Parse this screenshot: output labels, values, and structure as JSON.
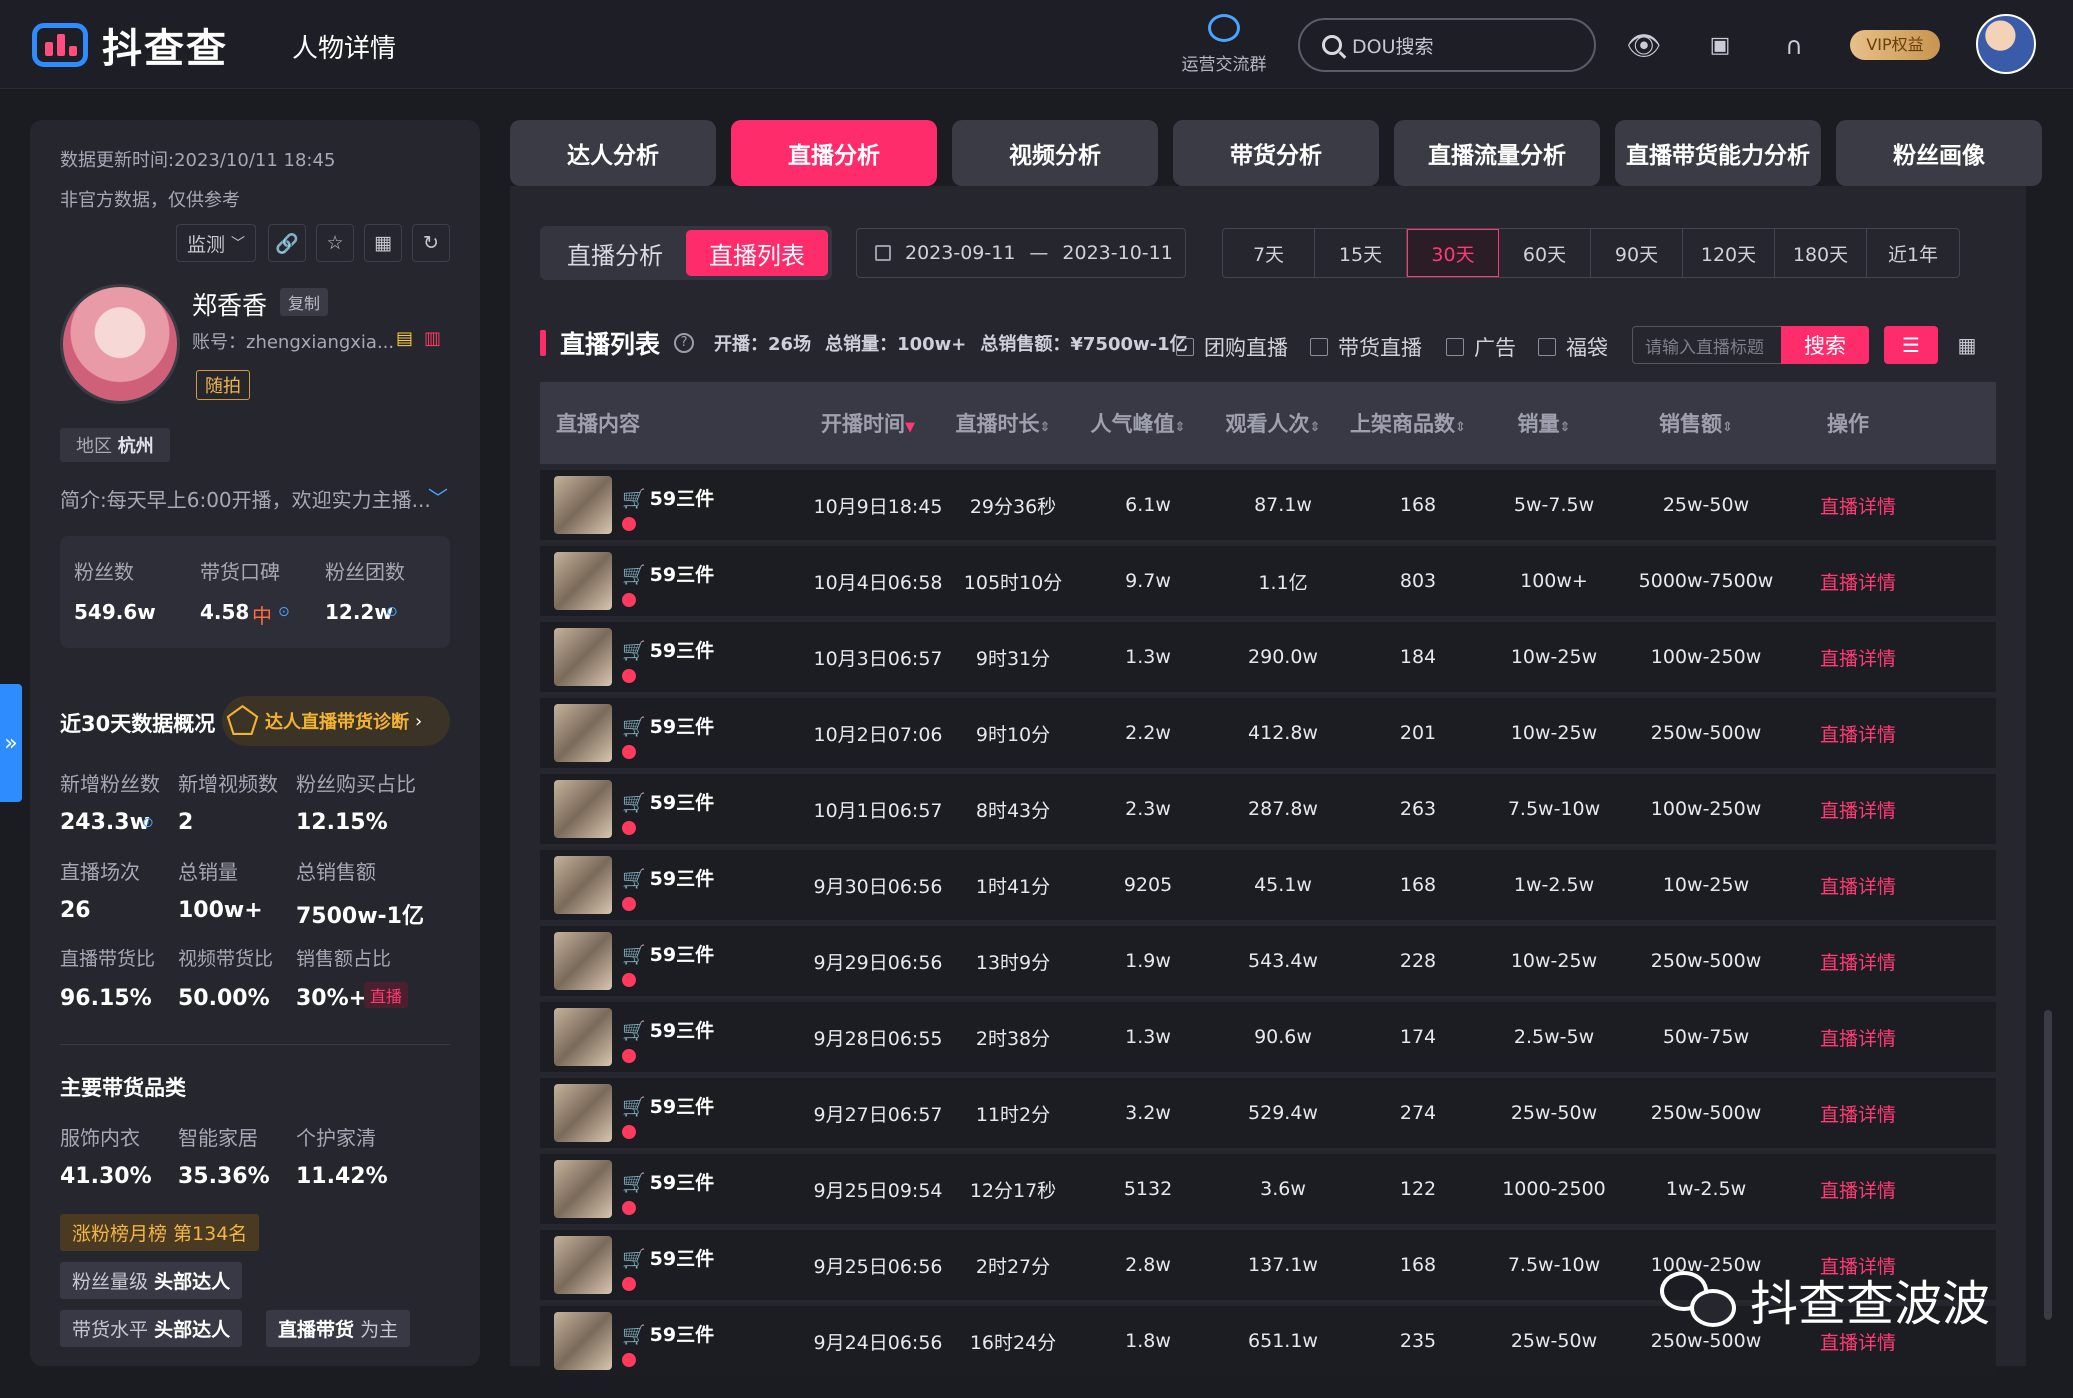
{
  "header": {
    "logo_text": "抖查查",
    "page_title": "人物详情",
    "group_label": "运营交流群",
    "search_placeholder": "DOU搜索",
    "vip_label": "VIP权益"
  },
  "profile": {
    "update_time": "数据更新时间:2023/10/11 18:45",
    "unofficial": "非官方数据，仅供参考",
    "monitor_label": "监测",
    "name": "郑香香",
    "copy_label": "复制",
    "account": "账号：zhengxiangxia...",
    "tag": "随拍",
    "region_label": "地区",
    "region": "杭州",
    "intro": "简介:每天早上6:00开播，欢迎实力主播...",
    "stats": [
      {
        "label": "粉丝数",
        "value": "549.6w"
      },
      {
        "label": "带货口碑",
        "value": "4.58",
        "extra": "中"
      },
      {
        "label": "粉丝团数",
        "value": "12.2w"
      }
    ]
  },
  "overview": {
    "title": "近30天数据概况",
    "diagnose_label": "达人直播带货诊断",
    "rows": [
      [
        {
          "label": "新增粉丝数",
          "value": "243.3w"
        },
        {
          "label": "新增视频数",
          "value": "2"
        },
        {
          "label": "粉丝购买占比",
          "value": "12.15%"
        }
      ],
      [
        {
          "label": "直播场次",
          "value": "26"
        },
        {
          "label": "总销量",
          "value": "100w+"
        },
        {
          "label": "总销售额",
          "value": "7500w-1亿"
        }
      ],
      [
        {
          "label": "直播带货比",
          "value": "96.15%"
        },
        {
          "label": "视频带货比",
          "value": "50.00%"
        },
        {
          "label": "销售额占比",
          "value": "30%+"
        }
      ]
    ],
    "live_badge": "直播"
  },
  "categories": {
    "title": "主要带货品类",
    "items": [
      {
        "label": "服饰内衣",
        "value": "41.30%"
      },
      {
        "label": "智能家居",
        "value": "35.36%"
      },
      {
        "label": "个护家清",
        "value": "11.42%"
      }
    ],
    "rank_chip": "涨粉榜月榜 第134名",
    "chip1_label": "粉丝量级",
    "chip1_value": "头部达人",
    "chip2_label": "带货水平",
    "chip2_value": "头部达人",
    "chip3_label": "直播带货",
    "chip3_value": "为主"
  },
  "tabs": [
    "达人分析",
    "直播分析",
    "视频分析",
    "带货分析",
    "直播流量分析",
    "直播带货能力分析",
    "粉丝画像"
  ],
  "subtabs": [
    "直播分析",
    "直播列表"
  ],
  "date_range": {
    "start": "2023-09-11",
    "sep": "—",
    "end": "2023-10-11"
  },
  "periods": [
    "7天",
    "15天",
    "30天",
    "60天",
    "90天",
    "120天",
    "180天",
    "近1年"
  ],
  "list": {
    "title": "直播列表",
    "stat_live": "开播：26场",
    "stat_sales": "总销量：100w+",
    "stat_amount": "总销售额：¥7500w-1亿",
    "filters": [
      "团购直播",
      "带货直播",
      "广告",
      "福袋"
    ],
    "search_placeholder": "请输入直播标题",
    "search_button": "搜索",
    "columns": [
      "直播内容",
      "开播时间",
      "直播时长",
      "人气峰值",
      "观看人次",
      "上架商品数",
      "销量",
      "销售额",
      "操作"
    ],
    "rows": [
      [
        "59三件",
        "10月9日18:45",
        "29分36秒",
        "6.1w",
        "87.1w",
        "168",
        "5w-7.5w",
        "25w-50w",
        "直播详情"
      ],
      [
        "59三件",
        "10月4日06:58",
        "105时10分",
        "9.7w",
        "1.1亿",
        "803",
        "100w+",
        "5000w-7500w",
        "直播详情"
      ],
      [
        "59三件",
        "10月3日06:57",
        "9时31分",
        "1.3w",
        "290.0w",
        "184",
        "10w-25w",
        "100w-250w",
        "直播详情"
      ],
      [
        "59三件",
        "10月2日07:06",
        "9时10分",
        "2.2w",
        "412.8w",
        "201",
        "10w-25w",
        "250w-500w",
        "直播详情"
      ],
      [
        "59三件",
        "10月1日06:57",
        "8时43分",
        "2.3w",
        "287.8w",
        "263",
        "7.5w-10w",
        "100w-250w",
        "直播详情"
      ],
      [
        "59三件",
        "9月30日06:56",
        "1时41分",
        "9205",
        "45.1w",
        "168",
        "1w-2.5w",
        "10w-25w",
        "直播详情"
      ],
      [
        "59三件",
        "9月29日06:56",
        "13时9分",
        "1.9w",
        "543.4w",
        "228",
        "10w-25w",
        "250w-500w",
        "直播详情"
      ],
      [
        "59三件",
        "9月28日06:55",
        "2时38分",
        "1.3w",
        "90.6w",
        "174",
        "2.5w-5w",
        "50w-75w",
        "直播详情"
      ],
      [
        "59三件",
        "9月27日06:57",
        "11时2分",
        "3.2w",
        "529.4w",
        "274",
        "25w-50w",
        "250w-500w",
        "直播详情"
      ],
      [
        "59三件",
        "9月25日09:54",
        "12分17秒",
        "5132",
        "3.6w",
        "122",
        "1000-2500",
        "1w-2.5w",
        "直播详情"
      ],
      [
        "59三件",
        "9月25日06:56",
        "2时27分",
        "2.8w",
        "137.1w",
        "168",
        "7.5w-10w",
        "100w-250w",
        "直播详情"
      ],
      [
        "59三件",
        "9月24日06:56",
        "16时24分",
        "1.8w",
        "651.1w",
        "235",
        "25w-50w",
        "250w-500w",
        "直播详情"
      ]
    ]
  },
  "watermark": "抖查查波波",
  "colors": {
    "accent": "#ff2c6c",
    "brand_blue": "#2e8cff",
    "background": "#1b1c22",
    "panel": "#25262e"
  }
}
